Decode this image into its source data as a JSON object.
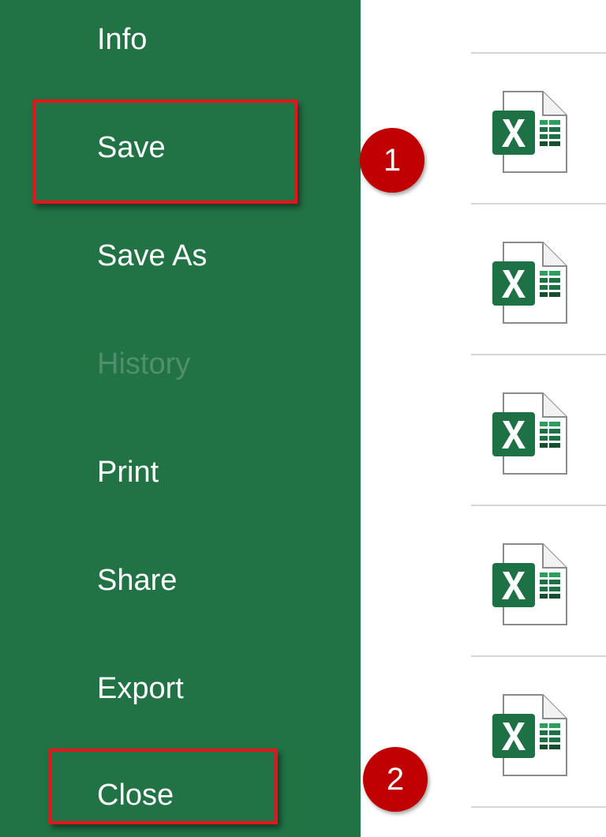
{
  "nav": {
    "items": [
      {
        "label": "Info",
        "state": "normal"
      },
      {
        "label": "Save",
        "state": "highlighted"
      },
      {
        "label": "Save As",
        "state": "normal"
      },
      {
        "label": "History",
        "state": "disabled"
      },
      {
        "label": "Print",
        "state": "normal"
      },
      {
        "label": "Share",
        "state": "normal"
      },
      {
        "label": "Export",
        "state": "normal"
      },
      {
        "label": "Close",
        "state": "highlighted"
      }
    ]
  },
  "markers": [
    "1",
    "2"
  ],
  "files": [
    {
      "icon": "excel-file-icon"
    },
    {
      "icon": "excel-file-icon"
    },
    {
      "icon": "excel-file-icon"
    },
    {
      "icon": "excel-file-icon"
    },
    {
      "icon": "excel-file-icon"
    }
  ],
  "colors": {
    "nav_background": "#217346",
    "nav_text": "#ffffff",
    "nav_disabled_text": "#4f8f6c",
    "highlight_border": "#e8141b",
    "marker_fill": "#c00000",
    "excel_green": "#1e7145"
  }
}
